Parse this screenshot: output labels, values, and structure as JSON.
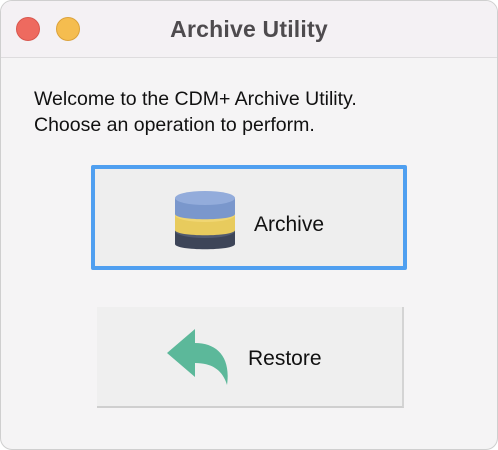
{
  "window": {
    "title": "Archive Utility",
    "controls": {
      "close": "close-button",
      "minimize": "minimize-button"
    }
  },
  "message": {
    "line1": "Welcome to the CDM+ Archive Utility.",
    "line2": "Choose an operation to perform."
  },
  "operations": [
    {
      "label": "Archive",
      "icon": "database-icon",
      "focused": true
    },
    {
      "label": "Restore",
      "icon": "undo-arrow-icon",
      "focused": false
    }
  ],
  "colors": {
    "focus_ring": "#4f9ff0",
    "close": "#ee6a5f",
    "minimize": "#f5bd4f",
    "db_top": "#7f9bd0",
    "db_mid": "#ebcf63",
    "db_bottom": "#3d4558",
    "restore_arrow": "#5cb89a"
  }
}
